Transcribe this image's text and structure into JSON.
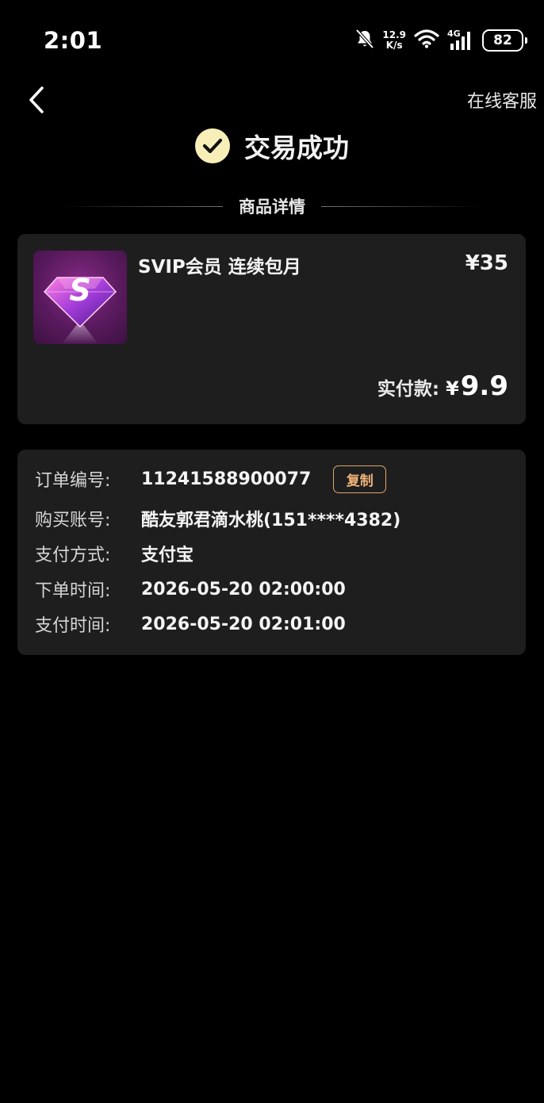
{
  "status_bar": {
    "time": "2:01",
    "net_speed_value": "12.9",
    "net_speed_unit": "K/s",
    "signal_label": "4G",
    "battery": "82"
  },
  "header": {
    "support_label": "在线客服"
  },
  "status": {
    "title": "交易成功"
  },
  "section": {
    "title": "商品详情"
  },
  "product": {
    "name": "SVIP会员 连续包月",
    "price": "¥35",
    "paid_label": "实付款:",
    "paid_currency": "¥",
    "paid_amount": "9.9",
    "image_letter": "S"
  },
  "order": {
    "rows": [
      {
        "label": "订单编号:",
        "value": "11241588900077"
      },
      {
        "label": "购买账号:",
        "value": "酷友郭君滴水桃(151****4382)"
      },
      {
        "label": "支付方式:",
        "value": "支付宝"
      },
      {
        "label": "下单时间:",
        "value": "2026-05-20 02:00:00"
      },
      {
        "label": "支付时间:",
        "value": "2026-05-20 02:01:00"
      }
    ],
    "copy_label": "复制"
  },
  "colors": {
    "background": "#000000",
    "card": "#1e1e1e",
    "success_circle": "#f8efb8",
    "copy_accent": "#e2a56a",
    "product_purple": "#5a1a5e"
  },
  "icons": {
    "back": "chevron-left-icon",
    "success": "check-circle-icon",
    "mute": "bell-off-icon",
    "wifi": "wifi-icon",
    "signal": "signal-bars-icon",
    "product": "diamond-s-icon"
  }
}
